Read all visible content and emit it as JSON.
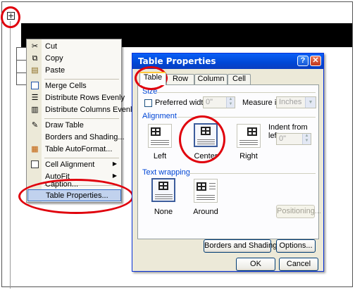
{
  "context_menu": {
    "items": [
      {
        "label": "Cut",
        "icon": "scissors-icon",
        "hotkey_index": 1
      },
      {
        "label": "Copy",
        "icon": "copy-icon",
        "hotkey_index": 0
      },
      {
        "label": "Paste",
        "icon": "paste-icon",
        "hotkey_index": 0
      },
      {
        "label": "Merge Cells",
        "icon": "merge-cells-icon",
        "hotkey_index": 0
      },
      {
        "label": "Distribute Rows Evenly",
        "icon": "distribute-rows-icon",
        "hotkey_index": 0
      },
      {
        "label": "Distribute Columns Evenly",
        "icon": "distribute-columns-icon",
        "hotkey_index": 0
      },
      {
        "label": "Draw Table",
        "icon": "draw-table-icon",
        "hotkey_index": 0
      },
      {
        "label": "Borders and Shading...",
        "icon": "",
        "hotkey_index": 0
      },
      {
        "label": "Table AutoFormat...",
        "icon": "table-autoformat-icon",
        "hotkey_index": 0
      },
      {
        "label": "Cell Alignment",
        "icon": "cell-alignment-icon",
        "hotkey_index": 0,
        "submenu": true
      },
      {
        "label": "AutoFit",
        "icon": "",
        "hotkey_index": 0,
        "submenu": true
      },
      {
        "label": "Caption...",
        "icon": "",
        "hotkey_index": 0
      },
      {
        "label": "Table Properties...",
        "icon": "",
        "hotkey_index": 0,
        "highlighted": true
      }
    ]
  },
  "dialog": {
    "title": "Table Properties",
    "help": "?",
    "close": "✕",
    "tabs": [
      "Table",
      "Row",
      "Column",
      "Cell"
    ],
    "active_tab": "Table",
    "size": {
      "group_label": "Size",
      "preferred_width_label": "Preferred width:",
      "preferred_width_value": "0\"",
      "measure_in_label": "Measure in:",
      "measure_in_value": "Inches"
    },
    "alignment": {
      "group_label": "Alignment",
      "options": [
        "Left",
        "Center",
        "Right"
      ],
      "selected": "Center",
      "indent_label": "Indent from left:",
      "indent_value": "0\""
    },
    "text_wrapping": {
      "group_label": "Text wrapping",
      "options": [
        "None",
        "Around"
      ],
      "selected": "None",
      "positioning_button": "Positioning..."
    },
    "borders_button": "Borders and Shading...",
    "options_button": "Options...",
    "ok_button": "OK",
    "cancel_button": "Cancel"
  },
  "colors": {
    "highlight_circle": "#e0000c",
    "title_bar": "#0a5ff6",
    "menu_highlight": "#c1d2ee"
  }
}
